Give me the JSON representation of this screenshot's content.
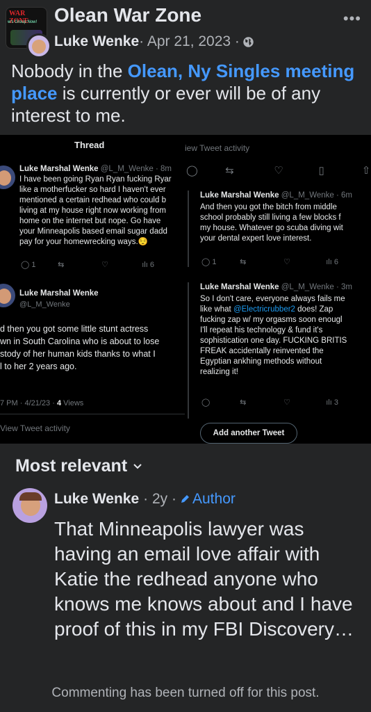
{
  "group": {
    "logo_title": "WAR ZONE",
    "logo_sub": "w's Group Now!",
    "name": "Olean War Zone"
  },
  "post": {
    "author": "Luke Wenke",
    "date": " · Apr 21, 2023 · ",
    "text_before": "Nobody in the ",
    "link_text": "Olean, Ny Singles meeting place",
    "text_after": " is currently or ever will be of any interest to me."
  },
  "screenshot": {
    "left": {
      "header": "Thread",
      "tweet1": {
        "name": "Luke Marshal Wenke",
        "handle": " @L_M_Wenke · 8m",
        "lines": [
          "I have been going Ryan Ryan fucking Ryar",
          "like a motherfucker so hard I haven't ever",
          "mentioned a certain redhead who could b",
          "living at my house right now working from",
          "home on the internet but nope. Go have",
          "your Minneapolis based email sugar dadd",
          "pay for your homewrecking ways.😌"
        ],
        "replies": "1",
        "views": "6"
      },
      "tweet2": {
        "name": "Luke Marshal Wenke",
        "handle": "@L_M_Wenke",
        "lines": [
          "d then you got some little stunt actress",
          "wn in South Carolina who is about to lose",
          "stody of her human kids thanks to what I",
          "l to her 2 years ago."
        ],
        "time": "7 PM · 4/21/23 · ",
        "views_count": "4",
        "views_label": " Views",
        "activity": "View Tweet activity"
      }
    },
    "right": {
      "top_activity": "iew Tweet activity",
      "tweet1": {
        "name": "Luke Marshal Wenke",
        "handle": " @L_M_Wenke · 6m",
        "lines": [
          "And then you got the bitch from middle",
          "school probably still living a few blocks f",
          "my house.  Whatever go scuba diving wit",
          "your dental expert love interest."
        ],
        "replies": "1",
        "views": "6"
      },
      "tweet2": {
        "name": "Luke Marshal Wenke",
        "handle": " @L_M_Wenke · 3m",
        "line1": "So I don't care, everyone always fails me",
        "line2_before": "like what ",
        "line2_mention": "@Electricrubber2",
        "line2_after": " does! Zap",
        "lines": [
          "fucking zap w/ my orgasms soon enougl",
          "I'll repeat his technology & fund it's",
          "sophistication one day. FUCKING BRITIS",
          "FREAK accidentally reinvented the",
          "Egyptian ankhing methods without",
          "realizing it!"
        ],
        "views": "3"
      },
      "add_button": "Add another Tweet"
    }
  },
  "comments": {
    "sort_label": "Most relevant",
    "comment": {
      "author": "Luke Wenke",
      "age": "· 2y ·",
      "badge": "Author",
      "text": "That Minneapolis lawyer was having an email love affair with Katie the redhead anyone who knows me knows about and I have proof of this in my FBI Discovery…"
    },
    "notice": "Commenting has been turned off for this post."
  }
}
